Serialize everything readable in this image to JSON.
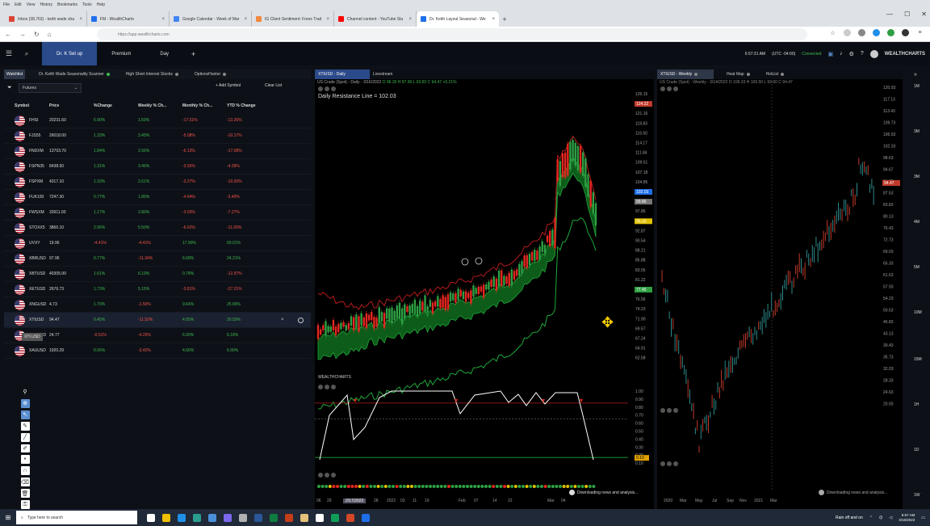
{
  "browser": {
    "menu": [
      "File",
      "Edit",
      "View",
      "History",
      "Bookmarks",
      "Tools",
      "Help"
    ],
    "tabs": [
      {
        "title": "Inbox (38,763) - keith wade sha",
        "color": "#db4437",
        "active": false
      },
      {
        "title": "FM - WealthCharts",
        "color": "#1f6feb",
        "active": false
      },
      {
        "title": "Google Calendar - Week of Mar",
        "color": "#4285f4",
        "active": false
      },
      {
        "title": "IG Client Sentiment: Forex Trad",
        "color": "#f0883e",
        "active": false
      },
      {
        "title": "Channel content - YouTube Stu",
        "color": "#ff0000",
        "active": false
      },
      {
        "title": "Dr. Keith Layout Seasonal - We",
        "color": "#1f6feb",
        "active": true
      }
    ],
    "url": "https://app.wealthcharts.com"
  },
  "appnav": {
    "tabs": [
      {
        "label": "Dr. K Set up",
        "active": true
      },
      {
        "label": "Premium",
        "active": false
      },
      {
        "label": "Day",
        "active": false
      }
    ],
    "time": "6:57:31 AM",
    "timezone": "(UTC -04:00)",
    "status": "Connected",
    "brand": "WEALTHCHARTS"
  },
  "watchlist": {
    "tabs": [
      {
        "label": "Watchlist",
        "active": true,
        "dot": false
      },
      {
        "label": "Dr. Keith Wade Seasonality Scanner",
        "active": false,
        "dot": true
      },
      {
        "label": "High Short Interest Stocks",
        "active": false,
        "dot": false
      },
      {
        "label": "OptionsHunter",
        "active": false,
        "dot": false
      }
    ],
    "list_select": "Futures",
    "add_symbol": "+ Add Symbol",
    "clear_list": "Clear List",
    "columns": [
      "Symbol",
      "Price",
      "%Change",
      "Weekly % Ch...",
      "Monthly % Ch...",
      "YTD % Change"
    ],
    "rows": [
      {
        "symbol": "FHSI",
        "price": "20231.60",
        "chg": "6.90%",
        "wk": "1.59%",
        "mo": "-17.51%",
        "ytd": "-13.26%"
      },
      {
        "symbol": "FJS55",
        "price": "26018.00",
        "chg": "1.33%",
        "wk": "3.45%",
        "mo": "-5.08%",
        "ytd": "-10.17%"
      },
      {
        "symbol": "FNDXM",
        "price": "13703.70",
        "chg": "1.84%",
        "wk": "2.56%",
        "mo": "-6.13%",
        "ytd": "-17.08%"
      },
      {
        "symbol": "FSPN35",
        "price": "8438.50",
        "chg": "1.31%",
        "wk": "3.46%",
        "mo": "-3.55%",
        "ytd": "-4.39%"
      },
      {
        "symbol": "FSPXM",
        "price": "4317.10",
        "chg": "1.33%",
        "wk": "2.61%",
        "mo": "-3.27%",
        "ytd": "-10.00%"
      },
      {
        "symbol": "FUK100",
        "price": "7247.30",
        "chg": "0.77%",
        "wk": "1.85%",
        "mo": "-4.64%",
        "ytd": "-3.40%"
      },
      {
        "symbol": "FWSXM",
        "price": "33911.00",
        "chg": "1.17%",
        "wk": "2.80%",
        "mo": "-3.03%",
        "ytd": "-7.27%"
      },
      {
        "symbol": "STOXX5",
        "price": "3866.10",
        "chg": "2.96%",
        "wk": "5.50%",
        "mo": "-6.62%",
        "ytd": "-11.05%"
      },
      {
        "symbol": "UVXY",
        "price": "19.96",
        "chg": "-4.41%",
        "wk": "-4.41%",
        "mo": "17.90%",
        "ytd": "69.01%"
      },
      {
        "symbol": "XBRUSD",
        "price": "97.96",
        "chg": "0.77%",
        "wk": "-11.34%",
        "mo": "6.68%",
        "ytd": "24.21%"
      },
      {
        "symbol": "XBTUSD",
        "price": "40305.00",
        "chg": "1.61%",
        "wk": "6.19%",
        "mo": "0.78%",
        "ytd": "-12.97%"
      },
      {
        "symbol": "XETUSD",
        "price": "2676.73",
        "chg": "1.73%",
        "wk": "5.15%",
        "mo": "-3.81%",
        "ytd": "-27.21%"
      },
      {
        "symbol": "XNGUSD",
        "price": "4.73",
        "chg": "1.70%",
        "wk": "-1.50%",
        "mo": "9.64%",
        "ytd": "25.80%"
      },
      {
        "symbol": "XTIUSD",
        "price": "94.47",
        "chg": "0.45%",
        "wk": "-11.52%",
        "mo": "4.55%",
        "ytd": "20.50%",
        "selected": true
      },
      {
        "symbol": "XAGUSD",
        "price": "24.77",
        "chg": "-0.51%",
        "wk": "-4.25%",
        "mo": "6.00%",
        "ytd": "6.18%"
      },
      {
        "symbol": "XAUUSD",
        "price": "1920.29",
        "chg": "0.06%",
        "wk": "-3.42%",
        "mo": "4.66%",
        "ytd": "6.90%"
      }
    ],
    "tooltip": "XTI.USD"
  },
  "center_chart": {
    "tabs": [
      {
        "label": "XTIUSD - Daily",
        "active": true
      },
      {
        "label": "Livestream",
        "active": false
      }
    ],
    "subtitle": "US Crude (Spot) - Daily - 3/16/2022",
    "ohlc": "O 96.30 H 97.96 L 93.60 C 94.47 +0.21%",
    "annotation": "Daily Resistance Line = 102.03",
    "indicator_logo": "WEALTHCHARTS",
    "news": "Downloading news and analysis...",
    "price_labels": [
      "126.15",
      "123.82",
      "121.16",
      "118.83",
      "116.50",
      "114.17",
      "111.84",
      "109.51",
      "107.18",
      "104.85",
      "102.03",
      "99.86",
      "97.86",
      "95.33",
      "92.87",
      "90.54",
      "88.21",
      "85.88",
      "83.55",
      "81.22",
      "78.89",
      "76.56",
      "74.23",
      "71.90",
      "69.57",
      "67.24",
      "64.91",
      "62.58"
    ],
    "tags": [
      {
        "text": "124.22",
        "bg": "#c0392b",
        "row": 1
      },
      {
        "text": "102.03",
        "bg": "#1f6feb",
        "row": 10
      },
      {
        "text": "99.86",
        "bg": "#777777",
        "row": 11
      },
      {
        "text": "95.33",
        "bg": "#e0c000",
        "row": 13
      },
      {
        "text": "77.45",
        "bg": "#2ea043",
        "row": 20
      }
    ],
    "osc_labels": [
      "1.00",
      "0.90",
      "0.80",
      "0.70",
      "0.60",
      "0.50",
      "0.40",
      "0.30",
      "0.20",
      "0.10"
    ],
    "osc_tag": "0.10",
    "dates": [
      {
        "text": "06",
        "pos": 2
      },
      {
        "text": "29",
        "pos": 15
      },
      {
        "text": "2/17/2022",
        "pos": 35,
        "cur": true
      },
      {
        "text": "28",
        "pos": 73
      },
      {
        "text": "2022",
        "pos": 89
      },
      {
        "text": "03",
        "pos": 106
      },
      {
        "text": "11",
        "pos": 121
      },
      {
        "text": "19",
        "pos": 136
      },
      {
        "text": "Feb",
        "pos": 178
      },
      {
        "text": "07",
        "pos": 197
      },
      {
        "text": "14",
        "pos": 220
      },
      {
        "text": "22",
        "pos": 239
      },
      {
        "text": "Mar",
        "pos": 288
      },
      {
        "text": "04",
        "pos": 305
      }
    ]
  },
  "right_chart": {
    "tabs": [
      {
        "label": "XTIUSD - Weekly",
        "active": true
      },
      {
        "label": "Heat Map",
        "active": false
      },
      {
        "label": "HotList",
        "active": false
      }
    ],
    "subtitle": "US Crude (Spot) - Weekly - 3/14/2022  O 109.33 H 109.50 L 93.60 C 94.47",
    "price_labels": [
      "120.93",
      "117.13",
      "113.43",
      "109.73",
      "106.03",
      "102.33",
      "98.63",
      "94.67",
      "91.23",
      "87.53",
      "83.83",
      "80.13",
      "76.43",
      "72.73",
      "69.03",
      "65.33",
      "61.63",
      "57.93",
      "54.23",
      "50.53",
      "46.83",
      "43.13",
      "39.43",
      "35.73",
      "32.03",
      "28.33",
      "24.63",
      "20.93"
    ],
    "tag": "94.47",
    "news": "Downloading news and analysis...",
    "dates": [
      {
        "text": "2020",
        "pos": 8
      },
      {
        "text": "Mar",
        "pos": 28
      },
      {
        "text": "May",
        "pos": 47
      },
      {
        "text": "Jul",
        "pos": 68
      },
      {
        "text": "Sep",
        "pos": 86
      },
      {
        "text": "Nov",
        "pos": 102
      },
      {
        "text": "2021",
        "pos": 120
      },
      {
        "text": "Mar",
        "pos": 140
      }
    ]
  },
  "timeframes": [
    "1M",
    "3M",
    "3M",
    "4M",
    "5M",
    "10M",
    "15M",
    "1H",
    "1D",
    "1W"
  ],
  "taskbar": {
    "search_placeholder": "Type here to search",
    "weather": "Rain off and on",
    "time": "6:57 AM",
    "date": "3/16/2022",
    "icon_colors": [
      "#ffffff",
      "#f0c000",
      "#1f8fe8",
      "#2a9d8f",
      "#4a90d9",
      "#7b68ee",
      "#b0b0b0",
      "#2b579a",
      "#107c41",
      "#c43e1c",
      "#e5c07b",
      "#ffffff",
      "#0f9d58",
      "#d24726",
      "#1f6feb"
    ]
  },
  "colors": {
    "accent": "#2b4a8a",
    "up": "#3fb950",
    "down": "#f85149"
  }
}
